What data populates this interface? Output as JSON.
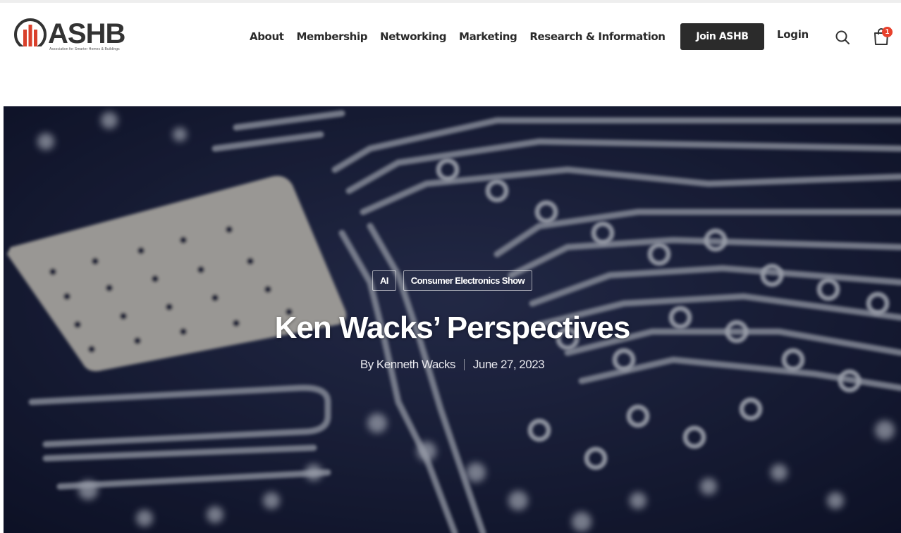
{
  "brand": {
    "name": "ASHB",
    "tagline": "Association for Smarter Homes & Buildings"
  },
  "nav": {
    "items": [
      {
        "label": "About"
      },
      {
        "label": "Membership"
      },
      {
        "label": "Networking"
      },
      {
        "label": "Marketing"
      },
      {
        "label": "Research & Information"
      }
    ],
    "join_label": "Join ASHB",
    "login_label": "Login",
    "cart_count": "1"
  },
  "hero": {
    "tags": [
      {
        "label": "AI"
      },
      {
        "label": "Consumer Electronics Show"
      }
    ],
    "title": "Ken Wacks’ Perspectives",
    "author": "By Kenneth Wacks",
    "date": "June 27, 2023"
  },
  "colors": {
    "accent_dark": "#2b2b2b",
    "logo_red": "#d9402b",
    "badge": "#e8412c",
    "hero_bg": "#141a33"
  }
}
